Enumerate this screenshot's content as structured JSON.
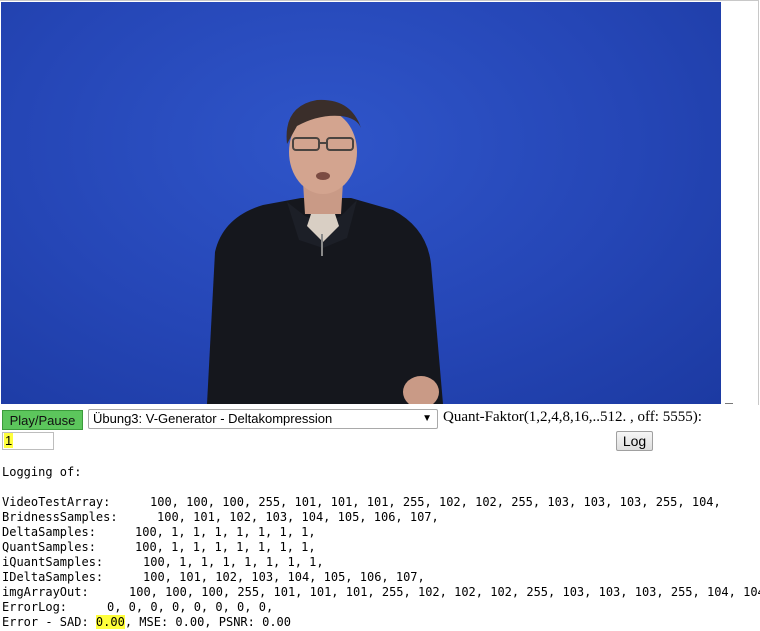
{
  "controls": {
    "play_label": "Play/Pause",
    "select_value": "Übung3: V-Generator - Deltakompression",
    "quant_label": "Quant-Faktor(1,2,4,8,16,..512. , off: 5555):",
    "quant_value": "1",
    "log_label": "Log"
  },
  "log": {
    "header": "Logging of:",
    "rows": [
      {
        "label": "VideoTestArray:",
        "values": "100, 100, 100, 255, 101, 101, 101, 255, 102, 102, 255, 103, 103, 103, 255, 104,"
      },
      {
        "label": "BridnessSamples:",
        "values": "100, 101, 102, 103, 104, 105, 106, 107,"
      },
      {
        "label": "DeltaSamples:",
        "values": "100, 1, 1, 1, 1, 1, 1, 1,"
      },
      {
        "label": "QuantSamples:",
        "values": "100, 1, 1, 1, 1, 1, 1, 1,"
      },
      {
        "label": "iQuantSamples:",
        "values": "100, 1, 1, 1, 1, 1, 1, 1,"
      },
      {
        "label": "IDeltaSamples:",
        "values": "100, 101, 102, 103, 104, 105, 106, 107,"
      },
      {
        "label": "imgArrayOut:",
        "values": "100, 100, 100, 255, 101, 101, 101, 255, 102, 102, 102, 255, 103, 103, 103, 255, 104, 104"
      },
      {
        "label": "ErrorLog:",
        "values": "0, 0, 0, 0, 0, 0, 0, 0,"
      }
    ],
    "error": {
      "prefix": "Error - SAD: ",
      "sad": "0.00",
      "rest": ", MSE: 0.00, PSNR: 0.00"
    }
  }
}
